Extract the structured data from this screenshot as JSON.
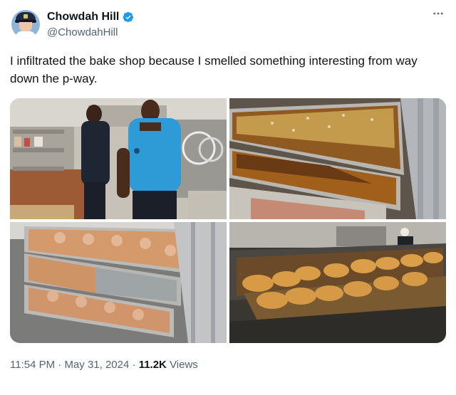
{
  "author": {
    "name": "Chowdah Hill",
    "handle": "@ChowdahHill",
    "verified": true
  },
  "tweet": {
    "text": "I infiltrated the bake shop because I smelled something interesting from way down the p-way."
  },
  "media": [
    {
      "description": "kitchen-staff-photo"
    },
    {
      "description": "sheet-cakes-on-rack-photo"
    },
    {
      "description": "cinnamon-rolls-on-rack-photo"
    },
    {
      "description": "muffins-on-trays-photo"
    }
  ],
  "meta": {
    "time": "11:54 PM",
    "dot": "·",
    "date": "May 31, 2024",
    "views_count": "11.2K",
    "views_label": "Views"
  },
  "icons": {
    "verified": "verified-badge-icon",
    "more": "more-options-icon"
  },
  "colors": {
    "verified": "#1d9bf0",
    "secondary_text": "#536471",
    "primary_text": "#0f1419"
  }
}
